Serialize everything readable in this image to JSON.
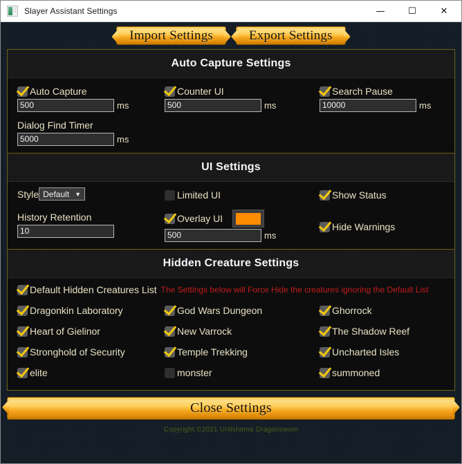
{
  "window": {
    "title": "Slayer Assistant Settings",
    "icon": "app-window-icon",
    "controls": {
      "minimize": "—",
      "maximize": "☐",
      "close": "✕"
    }
  },
  "toolbar": {
    "import_label": "Import Settings",
    "export_label": "Export Settings"
  },
  "colors": {
    "gold_border": "#6e6013",
    "label_text": "#e8e2c4",
    "warning_red": "#c01b1b",
    "overlay_swatch": "#ff8c00",
    "copyright_text": "#4d5c17",
    "panel_bg": "#0d0d0d",
    "window_bg": "#141e28"
  },
  "auto_capture": {
    "header": "Auto Capture Settings",
    "fields": [
      {
        "label": "Auto Capture",
        "checked": true,
        "value": "500",
        "unit": "ms"
      },
      {
        "label": "Counter UI",
        "checked": true,
        "value": "500",
        "unit": "ms"
      },
      {
        "label": "Search Pause",
        "checked": true,
        "value": "10000",
        "unit": "ms"
      }
    ],
    "dialog_find_timer": {
      "label": "Dialog Find Timer",
      "value": "5000",
      "unit": "ms"
    }
  },
  "ui_settings": {
    "header": "UI Settings",
    "style": {
      "label": "Style",
      "value": "Default",
      "caret": "▼"
    },
    "history_retention": {
      "label": "History Retention",
      "value": "10"
    },
    "limited_ui": {
      "label": "Limited UI",
      "checked": false
    },
    "overlay_ui": {
      "label": "Overlay UI",
      "checked": true,
      "value": "500",
      "unit": "ms",
      "swatch": "#ff8c00"
    },
    "show_status": {
      "label": "Show Status",
      "checked": true
    },
    "hide_warnings": {
      "label": "Hide Warnings",
      "checked": true
    }
  },
  "hidden_creatures": {
    "header": "Hidden Creature Settings",
    "default_list": {
      "label": "Default Hidden Creatures List",
      "checked": true
    },
    "warning": "The Settings below will Force Hide the creatures ignoring the Default List",
    "items": [
      {
        "label": "Dragonkin Laboratory",
        "checked": true
      },
      {
        "label": "God Wars Dungeon",
        "checked": true
      },
      {
        "label": "Ghorrock",
        "checked": true
      },
      {
        "label": "Heart of Gielinor",
        "checked": true
      },
      {
        "label": "New Varrock",
        "checked": true
      },
      {
        "label": "The Shadow Reef",
        "checked": true
      },
      {
        "label": "Stronghold of Security",
        "checked": true
      },
      {
        "label": "Temple Trekking",
        "checked": true
      },
      {
        "label": "Uncharted Isles",
        "checked": true
      },
      {
        "label": "elite",
        "checked": true
      },
      {
        "label": "monster",
        "checked": false
      },
      {
        "label": "summoned",
        "checked": true
      }
    ]
  },
  "footer": {
    "close_label": "Close Settings",
    "copyright": "Copyright ©2021 Unlishema Dragonsworn"
  }
}
